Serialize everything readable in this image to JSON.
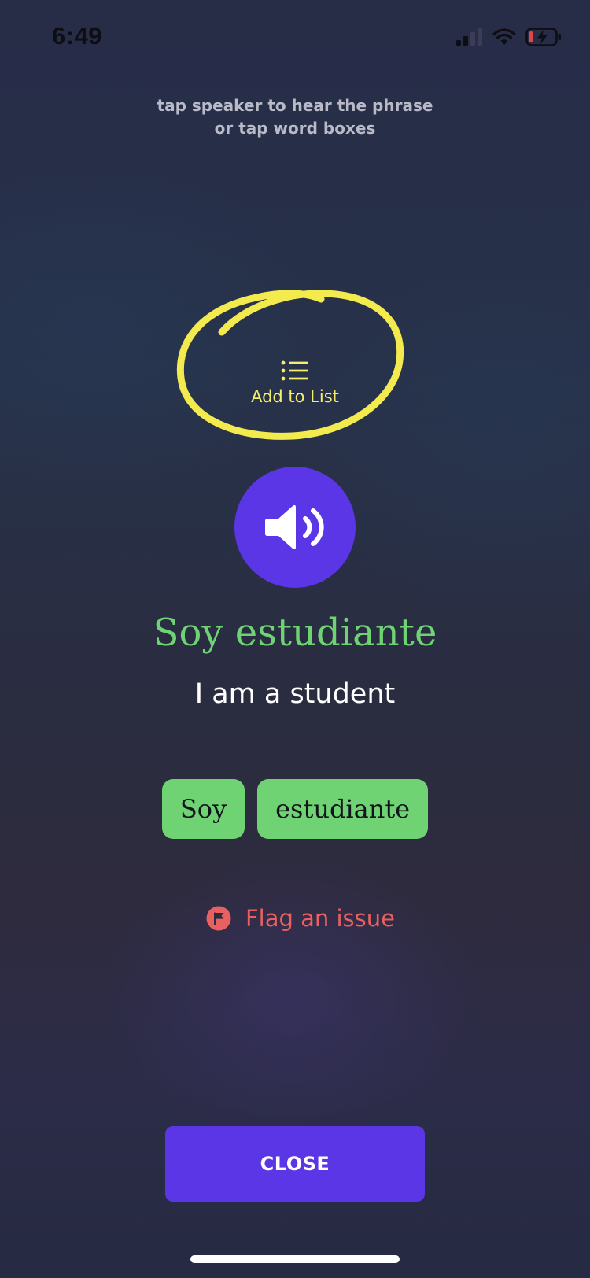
{
  "status_bar": {
    "time": "6:49",
    "icons": [
      "cellular-signal-icon",
      "wifi-icon",
      "battery-charging-icon"
    ],
    "battery_low_color": "#e04646"
  },
  "hint": {
    "line1": "tap speaker to hear the phrase",
    "line2": "or tap word boxes"
  },
  "add_to_list": {
    "icon": "list-icon",
    "label": "Add to List",
    "color": "#f5ee6a"
  },
  "annotation": {
    "shape": "hand-drawn circle",
    "color": "#f3ea4e"
  },
  "speaker": {
    "icon": "speaker-icon",
    "color": "#5b36e6"
  },
  "phrase": {
    "text": "Soy estudiante",
    "color": "#6fd273"
  },
  "translation": {
    "text": "I am a student"
  },
  "words": [
    {
      "text": "Soy"
    },
    {
      "text": "estudiante"
    }
  ],
  "flag": {
    "icon": "flag-icon",
    "label": "Flag an issue",
    "color": "#e8605f"
  },
  "close_button": {
    "label": "CLOSE",
    "color": "#5b36e6"
  }
}
